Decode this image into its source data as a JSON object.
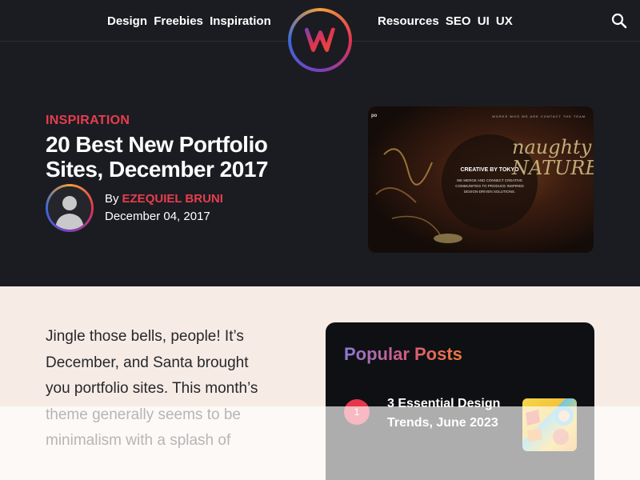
{
  "nav": {
    "left_items": [
      "Design",
      "Freebies",
      "Inspiration"
    ],
    "right_items": [
      "Resources",
      "SEO",
      "UI",
      "UX"
    ]
  },
  "article": {
    "category": "INSPIRATION",
    "title": "20 Best New Portfolio Sites, December 2017",
    "by_prefix": "By",
    "author": "EZEQUIEL BRUNI",
    "date": "December 04, 2017"
  },
  "thumbnail": {
    "logo": "po",
    "menu": "WORKS   WHO WE ARE   CONTACT   THE TEAM",
    "heading": "CREATIVE BY TOKYO",
    "subtext": "WE MERGE AND CONNECT CREATIVE COMMUNITIES TO PRODUCE INSPIRED DESIGN-DRIVEN SOLUTIONS.",
    "graffiti": "naughty NATURE"
  },
  "body": {
    "text": "Jingle those bells, people! It’s December, and Santa brought you portfolio sites. This month’s theme generally seems to be minimalism with a splash of"
  },
  "popular": {
    "title": "Popular Posts",
    "posts": [
      {
        "number": "1",
        "title": "3 Essential Design Trends, June 2023"
      }
    ]
  },
  "colors": {
    "accent": "#e63e4f",
    "dark": "#1b1c21",
    "background": "#f7ece5"
  }
}
